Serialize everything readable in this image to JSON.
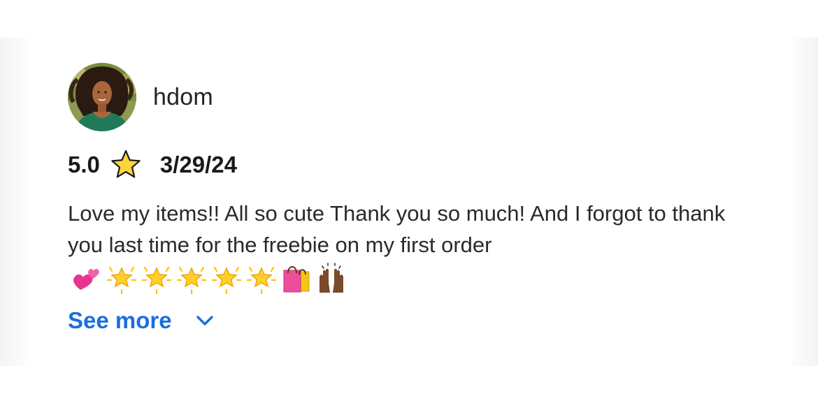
{
  "review": {
    "username": "hdom",
    "rating": "5.0",
    "date": "3/29/24",
    "text": "Love my items!! All so cute Thank you so much! And I forgot to thank you last time for the freebie on my first order",
    "emojis": [
      "two-hearts",
      "glowing-star",
      "glowing-star",
      "glowing-star",
      "glowing-star",
      "glowing-star",
      "shopping-bags",
      "raising-hands"
    ],
    "see_more_label": "See more"
  },
  "icons": {
    "rating_star": "star-icon",
    "expand": "chevron-down-icon",
    "avatar": "user-avatar"
  },
  "colors": {
    "link": "#1a6fdd",
    "star_fill": "#ffd43b",
    "star_outline": "#1a1a1a",
    "text": "#2a2a2a"
  }
}
